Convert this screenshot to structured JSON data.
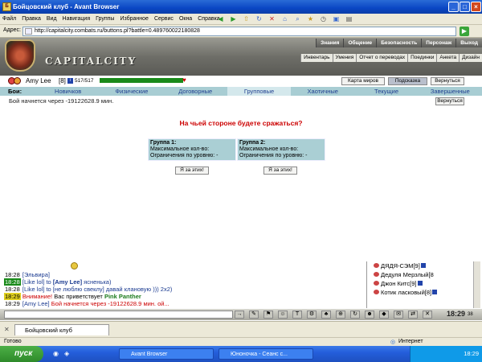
{
  "window": {
    "title": "Бойцовский клуб - Avant Browser",
    "controls": [
      "_",
      "□",
      "×"
    ]
  },
  "menu": [
    "Файл",
    "Правка",
    "Вид",
    "Навигация",
    "Группы",
    "Избранное",
    "Сервис",
    "Окна",
    "Справка"
  ],
  "address": {
    "label": "Адрес:",
    "url": "http://capitalcity.combats.ru/buttons.pl?battle=0.489760022180828"
  },
  "site": {
    "logo": "CAPITALCITY",
    "top_links": [
      "Знания",
      "Общение",
      "Безопасность",
      "Персонаж",
      "Выход"
    ],
    "sub_links": [
      "Инвентарь",
      "Умения",
      "Отчет о переводах",
      "Поединки",
      "Анкета",
      "Дизайн"
    ]
  },
  "player": {
    "name": "Amy Lee",
    "level": "[8]",
    "hp": "517/517",
    "hp_fraction": 1.0
  },
  "buttons": {
    "map": "Карта миров",
    "hint": "Подсказка",
    "back": "Вернуться",
    "back2": "Вернуться"
  },
  "tabs": {
    "label": "Бои:",
    "items": [
      "Новичков",
      "Физические",
      "Договорные",
      "Групповые",
      "Хаотичные",
      "Текущие",
      "Завершенные"
    ]
  },
  "status_text": "Бой начнется через -19122628.9 мин.",
  "question": "На чьей стороне будете сражаться?",
  "groups": [
    {
      "title": "Группа 1:",
      "max": "Максимальное кол-во:",
      "limit": "Ограничения по уровню: -",
      "join": "Я за этих!"
    },
    {
      "title": "Группа 2:",
      "max": "Максимальное кол-во:",
      "limit": "Ограничения по уровню: -",
      "join": "Я за этих!"
    }
  ],
  "chat": [
    {
      "time": "18:28",
      "hl": "",
      "pre": "[Эльвира]",
      "to": "",
      "msg": ""
    },
    {
      "time": "18:28",
      "hl": "g",
      "pre": "[Like lol] to ",
      "to": "[Amy Lee]",
      "msg": " ясненька)"
    },
    {
      "time": "18:28",
      "hl": "",
      "pre": "[Like lol] to ",
      "to": "",
      "msg": "[не люблю свеклу] давай клановую ))) 2х2)"
    },
    {
      "time": "18:29",
      "hl": "y",
      "pre": "Внимание!",
      "to": "",
      "msg": " Вас приветствует ",
      "nm": "Pink Panther"
    },
    {
      "time": "18:29",
      "hl": "",
      "pre": "[Amy Lee]",
      "to": "",
      "msg": " Бой начнется через -19122628.9 мин. ой..."
    }
  ],
  "users": [
    {
      "name": "ДЯДЯ-СЭМ",
      "level": "[9]"
    },
    {
      "name": "Дедуля Мерзлый",
      "level": "[8"
    },
    {
      "name": "Джон Китс",
      "level": "[9]"
    },
    {
      "name": "Котик ласковый",
      "level": "[8]"
    }
  ],
  "clock": {
    "time": "18:29",
    "sec": "38"
  },
  "browser_tab": "Бойцовский клуб",
  "statusbar": {
    "ready": "Готово",
    "zone": "Интернет"
  },
  "taskbar": {
    "start": "пуск",
    "tasks": [
      "Avant Browser",
      "Юноночка - Сеанс с..."
    ],
    "tray": "18:29"
  }
}
